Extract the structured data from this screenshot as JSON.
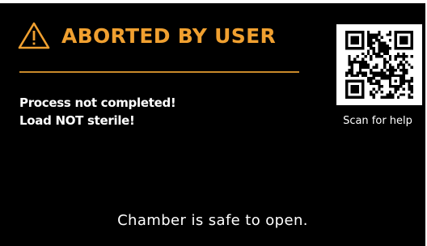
{
  "alert": {
    "icon": "warning-triangle-icon",
    "title": "ABORTED BY USER",
    "accent_color": "#f0a030"
  },
  "message": {
    "line1": "Process not completed!",
    "line2": "Load NOT sterile!"
  },
  "help": {
    "qr_icon": "qr-code-icon",
    "caption": "Scan for help"
  },
  "footer": {
    "status": "Chamber is safe to open."
  }
}
